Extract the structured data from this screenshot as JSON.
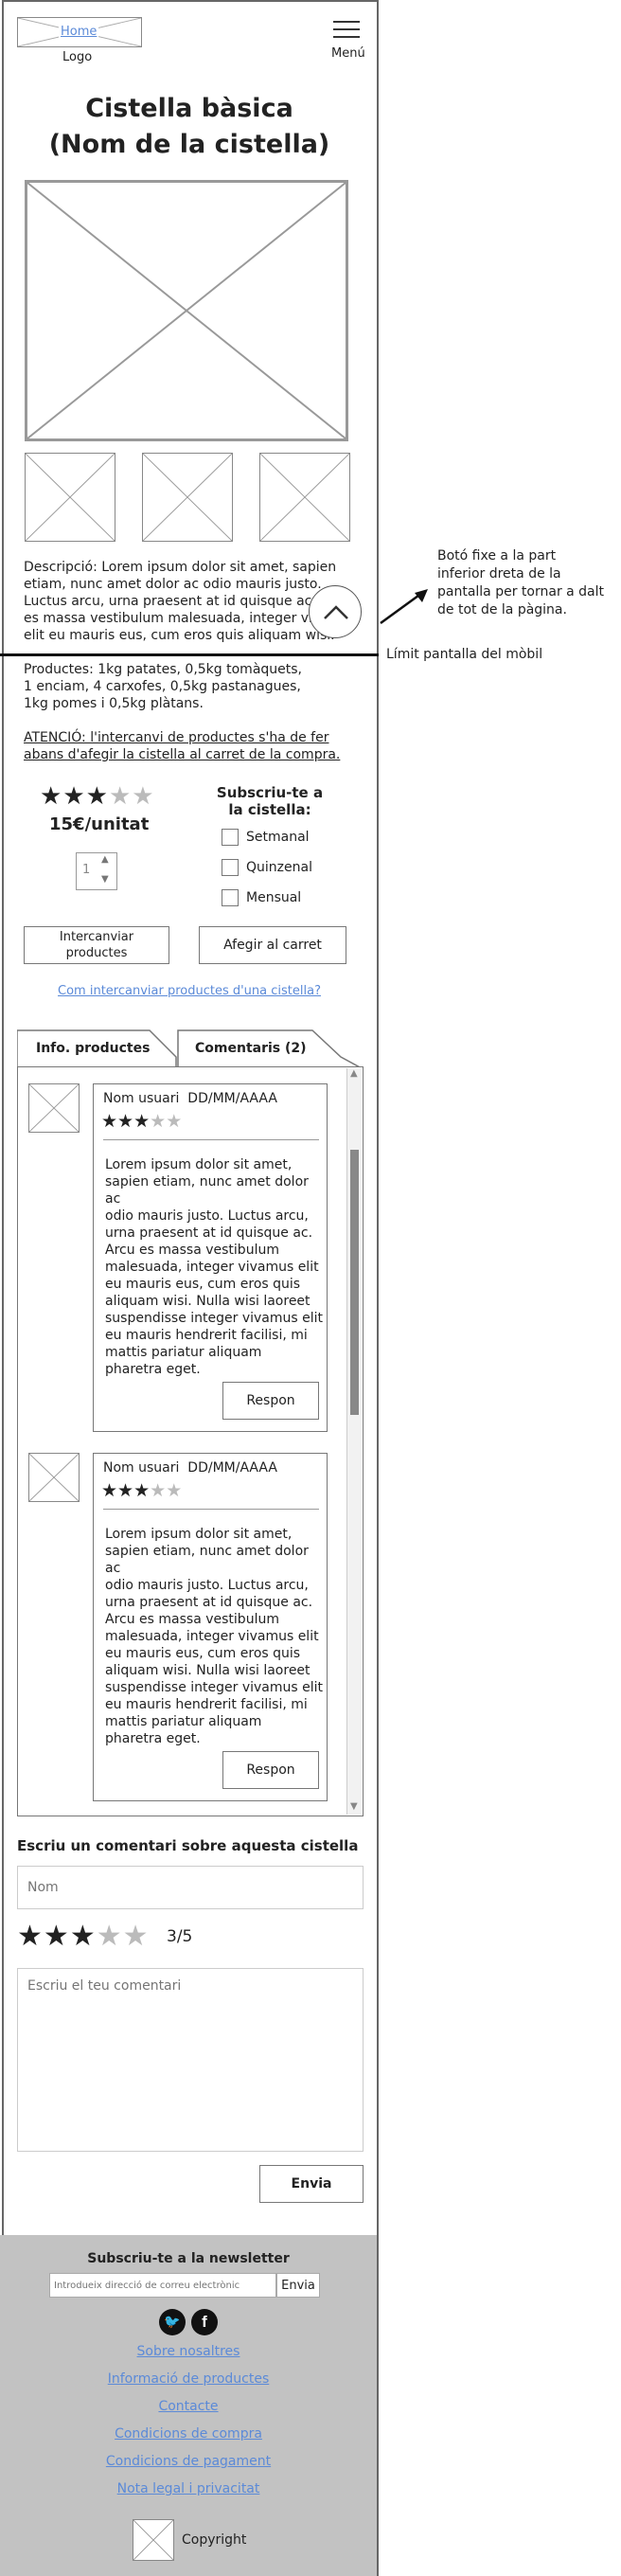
{
  "header": {
    "home_link": "Home",
    "logo_label": "Logo",
    "menu_label": "Menú"
  },
  "product": {
    "title_line1": "Cistella bàsica",
    "title_line2": "(Nom de la cistella)",
    "description_line1": "Descripció: Lorem ipsum dolor sit amet, sapien",
    "description_line2": "etiam, nunc amet dolor ac odio mauris justo.",
    "description_line3": "Luctus arcu, urna praesent at id quisque ac.",
    "description_line4": "es massa vestibulum malesuada, integer viva",
    "description_line5": "elit eu mauris eus, cum eros quis aliquam wisi.",
    "products_line1": "Productes: 1kg patates, 0,5kg tomàquets,",
    "products_line2": "1 enciam, 4 carxofes, 0,5kg pastanagues,",
    "products_line3": "1kg pomes i 0,5kg plàtans.",
    "warning_line1": "ATENCIÓ: l'intercanvi de productes s'ha de fer",
    "warning_line2": "abans d'afegir la cistella al carret de la compra.",
    "rating": 3,
    "rating_max": 5,
    "price": "15€/unitat",
    "quantity": "1",
    "subscribe_title_line1": "Subscriu-te a",
    "subscribe_title_line2": "la cistella:",
    "subscribe_options": [
      "Setmanal",
      "Quinzenal",
      "Mensual"
    ],
    "exchange_button": "Intercanviar productes",
    "add_cart_button": "Afegir al carret",
    "exchange_help_link": "Com intercanviar productes d'una cistella?"
  },
  "annotations": {
    "fixed_button_note_line1": "Botó fixe a la part",
    "fixed_button_note_line2": "inferior dreta de la",
    "fixed_button_note_line3": "pantalla per tornar a dalt",
    "fixed_button_note_line4": "de tot de la pàgina.",
    "mobile_limit": "Límit pantalla del mòbil"
  },
  "tabs": {
    "info": "Info. productes",
    "comments": "Comentaris (2)"
  },
  "comments": [
    {
      "user_date": "Nom usuari  DD/MM/AAAA",
      "rating": 3,
      "lines": [
        "Lorem ipsum dolor sit amet,",
        "sapien etiam, nunc amet dolor ac",
        "odio mauris justo. Luctus arcu,",
        "urna praesent at id quisque ac.",
        "Arcu es massa vestibulum",
        "malesuada, integer vivamus elit",
        "eu mauris eus, cum eros quis",
        "aliquam wisi. Nulla wisi laoreet",
        "suspendisse integer vivamus elit",
        "eu mauris hendrerit facilisi, mi",
        "mattis pariatur aliquam",
        "pharetra eget."
      ],
      "reply": "Respon"
    },
    {
      "user_date": "Nom usuari  DD/MM/AAAA",
      "rating": 3,
      "lines": [
        "Lorem ipsum dolor sit amet,",
        "sapien etiam, nunc amet dolor ac",
        "odio mauris justo. Luctus arcu,",
        "urna praesent at id quisque ac.",
        "Arcu es massa vestibulum",
        "malesuada, integer vivamus elit",
        "eu mauris eus, cum eros quis",
        "aliquam wisi. Nulla wisi laoreet",
        "suspendisse integer vivamus elit",
        "eu mauris hendrerit facilisi, mi",
        "mattis pariatur aliquam",
        "pharetra eget."
      ],
      "reply": "Respon"
    }
  ],
  "write_comment": {
    "title": "Escriu un comentari sobre aquesta cistella",
    "name_placeholder": "Nom",
    "rating_text": "3/5",
    "rating": 3,
    "comment_placeholder": "Escriu el teu comentari",
    "send_button": "Envia"
  },
  "footer": {
    "newsletter_title": "Subscriu-te a la newsletter",
    "newsletter_placeholder": "Introdueix direcció de correu electrònic",
    "newsletter_button": "Envia",
    "links": [
      "Sobre nosaltres",
      "Informació de productes",
      "Contacte",
      "Condicions de compra",
      "Condicions de pagament",
      "Nota legal i privacitat"
    ],
    "copyright": "Copyright"
  }
}
